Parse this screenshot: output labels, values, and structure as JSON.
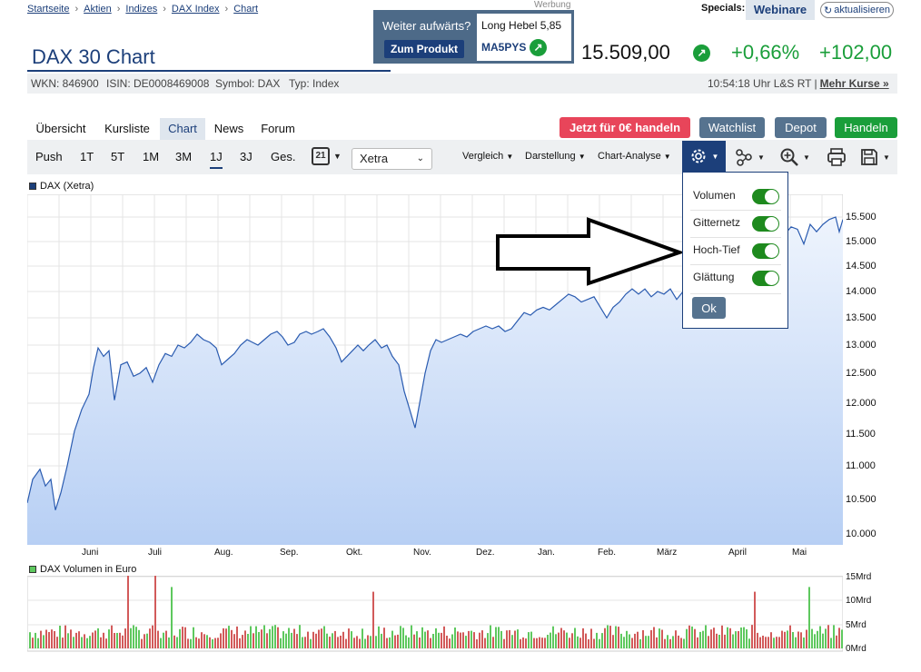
{
  "breadcrumb": [
    "Startseite",
    "Aktien",
    "Indizes",
    "DAX Index",
    "Chart"
  ],
  "ad": {
    "label": "Werbung",
    "question": "Weiter aufwärts?",
    "product_button": "Zum Produkt",
    "product_name": "Long Hebel 5,85",
    "product_code": "MA5PYS"
  },
  "specials": {
    "label": "Specials:",
    "webinare": "Webinare",
    "refresh": "aktualisieren"
  },
  "title": "DAX 30 Chart",
  "quote": {
    "price": "15.509,00",
    "change_pct": "+0,66%",
    "change_abs": "+102,00",
    "color_up": "#1a9e3a"
  },
  "info": {
    "wkn": "WKN: 846900",
    "isin": "ISIN: DE0008469008",
    "symbol": "Symbol: DAX",
    "type": "Typ: Index",
    "time": "10:54:18 Uhr L&S RT",
    "more_sep": "|",
    "more": "Mehr Kurse »"
  },
  "tabs": [
    "Übersicht",
    "Kursliste",
    "Chart",
    "News",
    "Forum"
  ],
  "actions": {
    "trade_free": "Jetzt für 0€ handeln",
    "watchlist": "Watchlist",
    "depot": "Depot",
    "handeln": "Handeln"
  },
  "ranges": [
    "Push",
    "1T",
    "5T",
    "1M",
    "3M",
    "1J",
    "3J",
    "Ges."
  ],
  "active_range": "1J",
  "calendar_day": "21",
  "exchange": {
    "selected": "Xetra"
  },
  "toolbar": {
    "vergleich": "Vergleich",
    "darstellung": "Darstellung",
    "analyse": "Chart-Analyse"
  },
  "settings": {
    "options": [
      {
        "label": "Volumen",
        "on": true
      },
      {
        "label": "Gitternetz",
        "on": true
      },
      {
        "label": "Hoch-Tief",
        "on": true
      },
      {
        "label": "Glättung",
        "on": true
      }
    ],
    "ok": "Ok"
  },
  "chart_legend": "DAX (Xetra)",
  "volume_legend": "DAX Volumen in Euro",
  "chart_data": [
    {
      "type": "area",
      "series": [
        {
          "name": "DAX (Xetra)",
          "approx_points": [
            [
              "Mai",
              10450
            ],
            [
              "Juni",
              11400
            ],
            [
              "Juni",
              12800
            ],
            [
              "Juli",
              12900
            ],
            [
              "Juli",
              13200
            ],
            [
              "Aug.",
              12700
            ],
            [
              "Aug.",
              13150
            ],
            [
              "Sep.",
              13200
            ],
            [
              "Sep.",
              12950
            ],
            [
              "Okt.",
              12650
            ],
            [
              "Okt.",
              12900
            ],
            [
              "Nov.",
              11600
            ],
            [
              "Nov.",
              13050
            ],
            [
              "Dez.",
              13300
            ],
            [
              "Jan.",
              13900
            ],
            [
              "Feb.",
              13950
            ],
            [
              "März",
              14000
            ],
            [
              "April",
              15200
            ],
            [
              "Mai",
              15500
            ]
          ]
        }
      ],
      "x_tick_labels": [
        "Juni",
        "Juli",
        "Aug.",
        "Sep.",
        "Okt.",
        "Nov.",
        "Dez.",
        "Jan.",
        "Feb.",
        "März",
        "April",
        "Mai"
      ],
      "y_tick_labels": [
        "15.500",
        "15.000",
        "14.500",
        "14.000",
        "13.500",
        "13.000",
        "12.500",
        "12.000",
        "11.500",
        "11.000",
        "10.500",
        "10.000"
      ],
      "ylim": [
        9900,
        15800
      ],
      "grid": true
    },
    {
      "type": "bar",
      "series": [
        {
          "name": "DAX Volumen in Euro"
        }
      ],
      "y_tick_labels": [
        "15Mrd",
        "10Mrd",
        "5Mrd",
        "0Mrd"
      ],
      "ylim": [
        0,
        15
      ],
      "colors": {
        "up": "#5ec85e",
        "down": "#d25a5a"
      }
    }
  ]
}
